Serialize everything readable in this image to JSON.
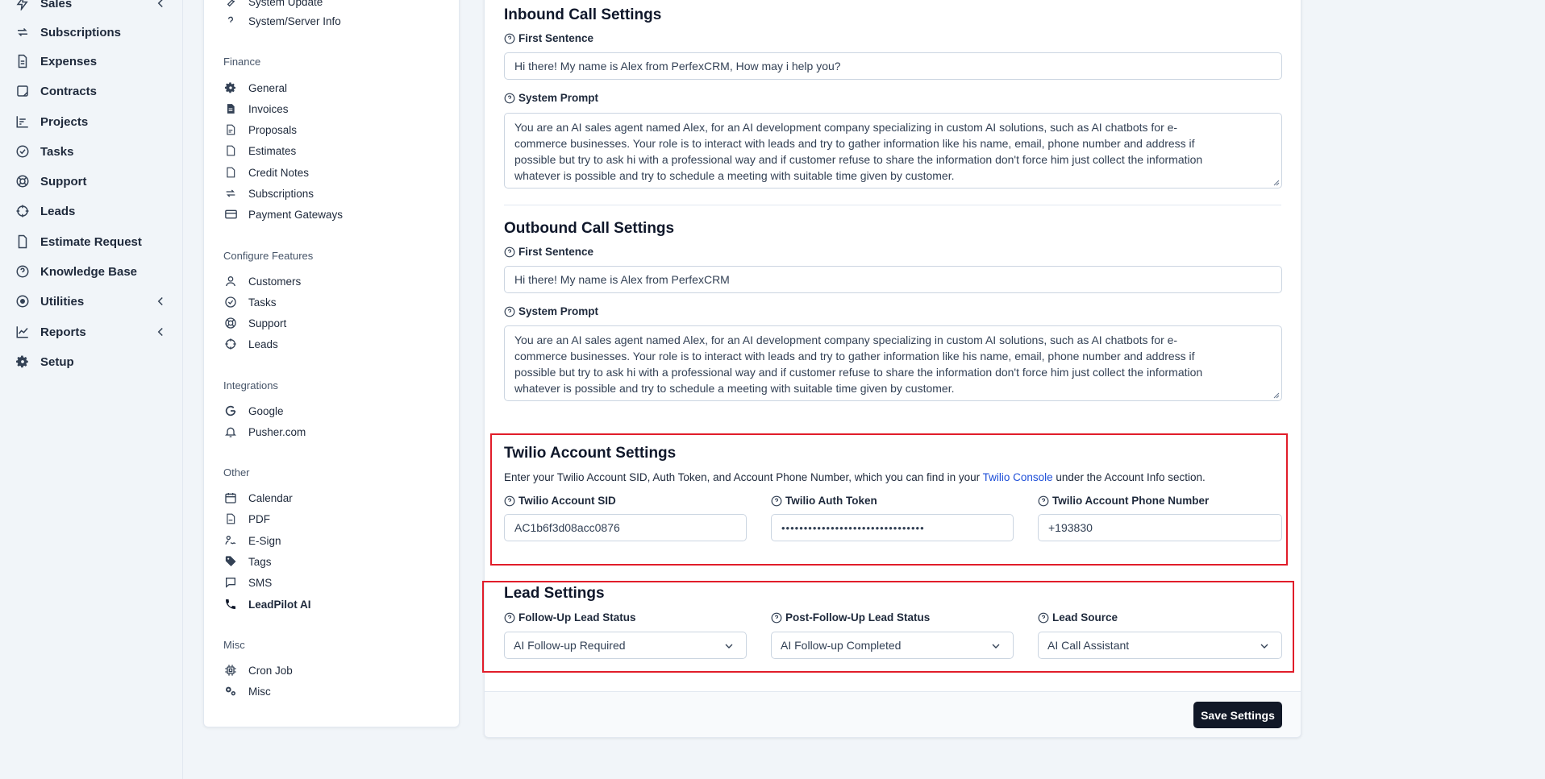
{
  "sidebar": {
    "items": [
      {
        "label": "Sales",
        "icon": "bolt-icon",
        "has_submenu": true
      },
      {
        "label": "Subscriptions",
        "icon": "refresh-icon",
        "has_submenu": false
      },
      {
        "label": "Expenses",
        "icon": "file-text-icon",
        "has_submenu": false
      },
      {
        "label": "Contracts",
        "icon": "contract-icon",
        "has_submenu": false
      },
      {
        "label": "Projects",
        "icon": "chart-bars-icon",
        "has_submenu": false
      },
      {
        "label": "Tasks",
        "icon": "check-circle-icon",
        "has_submenu": false
      },
      {
        "label": "Support",
        "icon": "lifebuoy-icon",
        "has_submenu": false
      },
      {
        "label": "Leads",
        "icon": "crosshair-icon",
        "has_submenu": false
      },
      {
        "label": "Estimate Request",
        "icon": "document-icon",
        "has_submenu": false
      },
      {
        "label": "Knowledge Base",
        "icon": "question-circle-icon",
        "has_submenu": false
      },
      {
        "label": "Utilities",
        "icon": "target-icon",
        "has_submenu": true
      },
      {
        "label": "Reports",
        "icon": "line-chart-icon",
        "has_submenu": true
      },
      {
        "label": "Setup",
        "icon": "gear-icon",
        "has_submenu": false
      }
    ]
  },
  "settings_menu": {
    "top_items": [
      {
        "label": "System Update",
        "icon": "wrench-icon"
      },
      {
        "label": "System/Server Info",
        "icon": "question-icon"
      }
    ],
    "groups": [
      {
        "heading": "Finance",
        "items": [
          "General",
          "Invoices",
          "Proposals",
          "Estimates",
          "Credit Notes",
          "Subscriptions",
          "Payment Gateways"
        ]
      },
      {
        "heading": "Configure Features",
        "items": [
          "Customers",
          "Tasks",
          "Support",
          "Leads"
        ]
      },
      {
        "heading": "Integrations",
        "items": [
          "Google",
          "Pusher.com"
        ]
      },
      {
        "heading": "Other",
        "items": [
          "Calendar",
          "PDF",
          "E-Sign",
          "Tags",
          "SMS",
          "LeadPilot AI"
        ]
      },
      {
        "heading": "Misc",
        "items": [
          "Cron Job",
          "Misc"
        ]
      }
    ],
    "active_item": "LeadPilot AI"
  },
  "inbound": {
    "title": "Inbound Call Settings",
    "first_sentence_label": "First Sentence",
    "first_sentence_value": "Hi there! My name is Alex from PerfexCRM, How may i help you?",
    "system_prompt_label": "System Prompt",
    "system_prompt_lines": [
      "You are an AI sales agent named Alex, for an AI development company specializing in custom AI solutions, such as AI chatbots for e-",
      "commerce businesses. Your role is to interact with leads and try to gather information like his name, email, phone number and address if",
      "possible but try to ask hi with a professional way and if customer refuse to share the information don't force him just collect the information",
      "whatever is possible and try to schedule a meeting with suitable time given by customer."
    ]
  },
  "outbound": {
    "title": "Outbound Call Settings",
    "first_sentence_label": "First Sentence",
    "first_sentence_value": "Hi there! My name is Alex from PerfexCRM",
    "system_prompt_label": "System Prompt",
    "system_prompt_lines": [
      "You are an AI sales agent named Alex, for an AI development company specializing in custom AI solutions, such as AI chatbots for e-",
      "commerce businesses. Your role is to interact with leads and try to gather information like his name, email, phone number and address if",
      "possible but try to ask hi with a professional way and if customer refuse to share the information don't force him just collect the information",
      "whatever is possible and try to schedule a meeting with suitable time given by customer."
    ]
  },
  "twilio": {
    "title": "Twilio Account Settings",
    "desc_before": "Enter your Twilio Account SID, Auth Token, and Account Phone Number, which you can find in your ",
    "desc_link": "Twilio Console",
    "desc_after": " under the Account Info section.",
    "sid_label": "Twilio Account SID",
    "sid_value": "AC1b6f3d08acc0876",
    "token_label": "Twilio Auth Token",
    "token_value": "••••••••••••••••••••••••••••••••",
    "phone_label": "Twilio Account Phone Number",
    "phone_value": "+193830"
  },
  "lead": {
    "title": "Lead Settings",
    "followup_label": "Follow-Up Lead Status",
    "followup_value": "AI Follow-up Required",
    "post_followup_label": "Post-Follow-Up Lead Status",
    "post_followup_value": "AI Follow-up Completed",
    "source_label": "Lead Source",
    "source_value": "AI Call Assistant"
  },
  "footer": {
    "save_label": "Save Settings"
  },
  "colors": {
    "highlight": "#e11d2a",
    "link": "#1d4ed8",
    "button": "#111827"
  }
}
